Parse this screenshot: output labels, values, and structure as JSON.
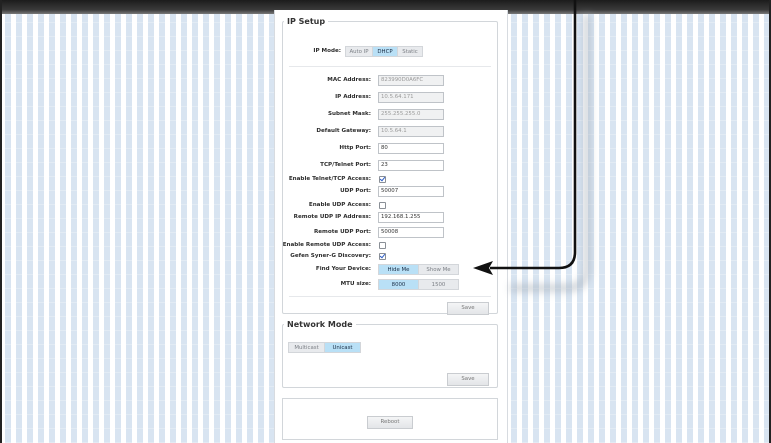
{
  "ip_setup": {
    "legend": "IP Setup",
    "ip_mode_label": "IP Mode:",
    "ip_mode_options": [
      "Auto IP",
      "DHCP",
      "Static"
    ],
    "ip_mode_selected": "DHCP",
    "mac_label": "MAC Address:",
    "mac_value": "823990D0A6FC",
    "ip_label": "IP Address:",
    "ip_value": "10.5.64.171",
    "subnet_label": "Subnet Mask:",
    "subnet_value": "255.255.255.0",
    "gateway_label": "Default Gateway:",
    "gateway_value": "10.5.64.1",
    "http_port_label": "Http Port:",
    "http_port_value": "80",
    "telnet_port_label": "TCP/Telnet Port:",
    "telnet_port_value": "23",
    "telnet_access_label": "Enable Telnet/TCP Access:",
    "udp_port_label": "UDP Port:",
    "udp_port_value": "50007",
    "udp_access_label": "Enable UDP Access:",
    "remote_udp_ip_label": "Remote UDP IP Address:",
    "remote_udp_ip_value": "192.168.1.255",
    "remote_udp_port_label": "Remote UDP Port:",
    "remote_udp_port_value": "50008",
    "remote_udp_access_label": "Enable Remote UDP Access:",
    "syner_label": "Gefen Syner-G Discovery:",
    "find_label": "Find Your Device:",
    "find_options": [
      "Hide Me",
      "Show Me"
    ],
    "find_selected": "Hide Me",
    "mtu_label": "MTU size:",
    "mtu_options": [
      "8000",
      "1500"
    ],
    "mtu_selected": "8000",
    "save_label": "Save"
  },
  "network_mode": {
    "legend": "Network Mode",
    "options": [
      "Multicast",
      "Unicast"
    ],
    "selected": "Unicast",
    "save_label": "Save"
  },
  "reboot": {
    "label": "Reboot"
  },
  "colors": {
    "accent": "#b9e0f6",
    "topbar": "#1c1c1c",
    "background_stripe": "#d8e4f1"
  }
}
